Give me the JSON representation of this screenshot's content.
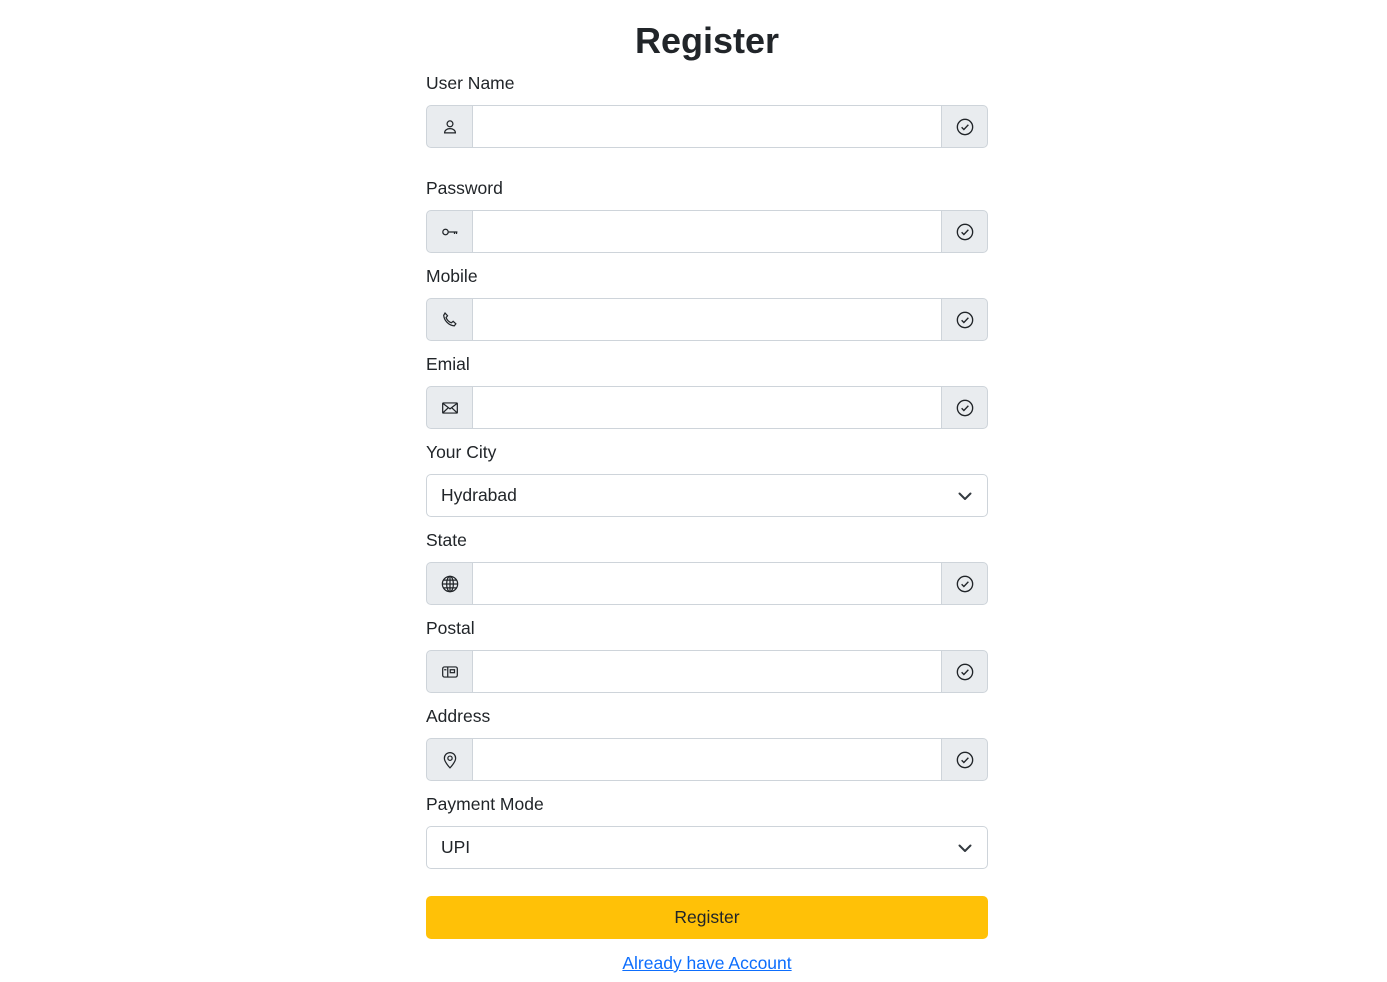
{
  "title": "Register",
  "fields": {
    "username": {
      "label": "User Name",
      "value": "",
      "icon": "person-icon"
    },
    "password": {
      "label": "Password",
      "value": "",
      "icon": "key-icon"
    },
    "mobile": {
      "label": "Mobile",
      "value": "",
      "icon": "telephone-icon"
    },
    "email": {
      "label": "Emial",
      "value": "",
      "icon": "envelope-icon"
    },
    "state": {
      "label": "State",
      "value": "",
      "icon": "globe-icon"
    },
    "postal": {
      "label": "Postal",
      "value": "",
      "icon": "postage-icon"
    },
    "address": {
      "label": "Address",
      "value": "",
      "icon": "geo-pin-icon"
    }
  },
  "city": {
    "label": "Your City",
    "selected": "Hydrabad"
  },
  "payment": {
    "label": "Payment Mode",
    "selected": "UPI"
  },
  "validation_icon": "check-circle-icon",
  "register_button": "Register",
  "login_link": "Already have Account",
  "colors": {
    "primary_button": "#ffc107",
    "link": "#0d6efd",
    "addon_bg": "#e9ecef",
    "border": "#ced4da"
  }
}
